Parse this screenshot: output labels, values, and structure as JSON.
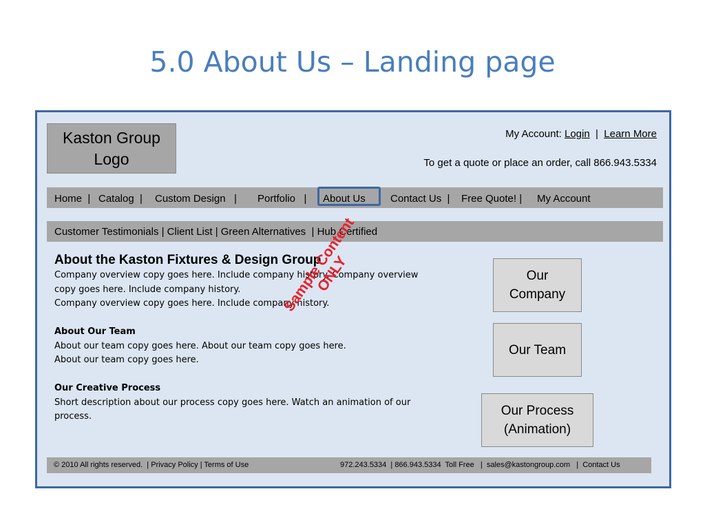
{
  "slide": {
    "title": "5.0 About Us – Landing page"
  },
  "header": {
    "logo_line1": "Kaston Group",
    "logo_line2": "Logo",
    "account_label": "My Account:",
    "login": "Login",
    "separator": "|",
    "learn_more": "Learn More",
    "quote": "To get a quote or place an order, call 866.943.5334"
  },
  "nav": {
    "items": [
      "Home  |",
      "Catalog  |",
      "Custom Design   |",
      "Portfolio   |",
      "About Us",
      "Contact Us  |",
      "Free Quote! |",
      "My Account"
    ],
    "active": "About Us"
  },
  "subnav": {
    "text": "Customer Testimonials | Client List | Green Alternatives  | Hub Certified"
  },
  "content": {
    "heading": "About the Kaston Fixtures & Design Group",
    "overview1": "Company overview copy goes here. Include company history. Company overview",
    "overview2": "copy goes here. Include company history.",
    "overview3": "Company overview copy goes here. Include company history.",
    "team_heading": "About Our Team",
    "team1": "About our team copy goes here. About our team copy goes here.",
    "team2": "About our team copy goes here.",
    "process_heading": "Our Creative Process",
    "process1": "Short description about our process copy goes here. Watch an animation of our",
    "process2": "process."
  },
  "stamp": {
    "line1": "Sample Content",
    "line2": "ONLY"
  },
  "sidebar": {
    "company_line1": "Our",
    "company_line2": "Company",
    "team": "Our Team",
    "process_line1": "Our Process",
    "process_line2": "(Animation)"
  },
  "footer": {
    "left": "© 2010 All rights reserved.  | Privacy Policy | Terms of Use",
    "right": "972.243.5334  | 866.943.5334  Toll Free   |  sales@kastongroup.com   |  Contact Us"
  },
  "colors": {
    "title": "#4a7ebb",
    "frame_border": "#3d67a4",
    "frame_bg": "#dce6f2",
    "bar_gray": "#a6a6a6",
    "stamp_red": "#e8202a"
  }
}
